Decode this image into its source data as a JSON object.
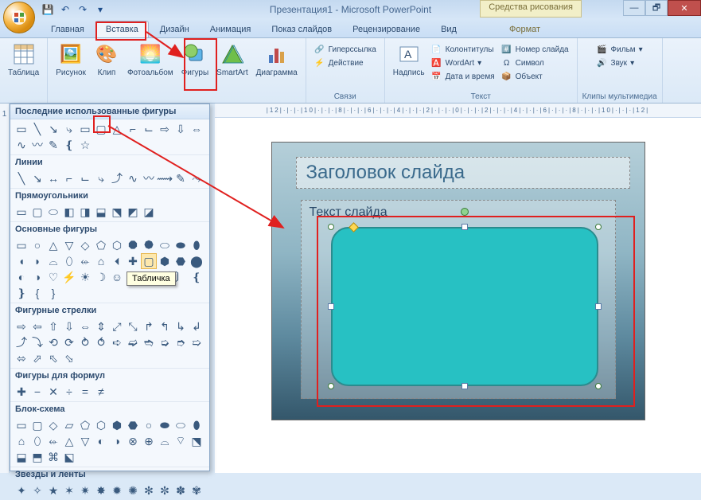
{
  "app": {
    "title": "Презентация1 - Microsoft PowerPoint",
    "context_tools": "Средства рисования"
  },
  "tabs": {
    "home": "Главная",
    "insert": "Вставка",
    "design": "Дизайн",
    "animation": "Анимация",
    "slideshow": "Показ слайдов",
    "review": "Рецензирование",
    "view": "Вид",
    "format": "Формат"
  },
  "ribbon": {
    "table": "Таблица",
    "picture": "Рисунок",
    "clip": "Клип",
    "photoalbum": "Фотоальбом",
    "shapes": "Фигуры",
    "smartart": "SmartArt",
    "chart": "Диаграмма",
    "links_group": "Связи",
    "hyperlink": "Гиперссылка",
    "action": "Действие",
    "textbox": "Надпись",
    "text_group": "Текст",
    "header_footer": "Колонтитулы",
    "wordart": "WordArt",
    "date_time": "Дата и время",
    "slide_number": "Номер слайда",
    "symbol": "Символ",
    "object": "Объект",
    "media_group": "Клипы мультимедиа",
    "movie": "Фильм",
    "sound": "Звук"
  },
  "shapes_gallery": {
    "recent": "Последние использованные фигуры",
    "lines": "Линии",
    "rectangles": "Прямоугольники",
    "basic": "Основные фигуры",
    "block_arrows": "Фигурные стрелки",
    "equation": "Фигуры для формул",
    "flowchart": "Блок-схема",
    "stars": "Звезды и ленты",
    "tooltip": "Табличка"
  },
  "slide": {
    "title_placeholder": "Заголовок слайда",
    "text_placeholder": "Текст слайда"
  },
  "ruler_text": "|12|·|·|·|10|·|·|·|8|·|·|·|6|·|·|·|4|·|·|·|2|·|·|·|0|·|·|·|2|·|·|·|4|·|·|·|6|·|·|·|8|·|·|·|10|·|·|·|12|",
  "thumbnail_index": "1"
}
